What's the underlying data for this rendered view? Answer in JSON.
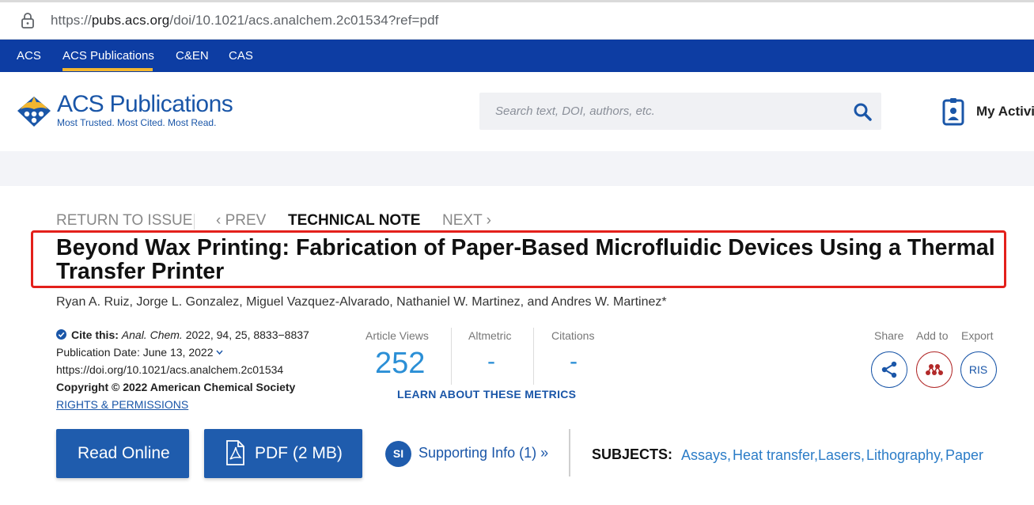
{
  "browser": {
    "url_prefix": "https://",
    "url_host": "pubs.acs.org",
    "url_path": "/doi/10.1021/acs.analchem.2c01534?ref=pdf"
  },
  "brand_nav": {
    "items": [
      {
        "label": "ACS",
        "active": false
      },
      {
        "label": "ACS Publications",
        "active": true
      },
      {
        "label": "C&EN",
        "active": false
      },
      {
        "label": "CAS",
        "active": false
      }
    ]
  },
  "header": {
    "logo_primary": "ACS",
    "logo_secondary": "Publications",
    "logo_tagline": "Most Trusted. Most Cited. Most Read.",
    "search_placeholder": "Search text, DOI, authors, etc.",
    "my_activity": "My Activit"
  },
  "article_nav": {
    "return": "RETURN TO ISSUE",
    "prev": "‹ PREV",
    "type": "TECHNICAL NOTE",
    "next": "NEXT ›"
  },
  "article": {
    "title": "Beyond Wax Printing: Fabrication of Paper-Based Microfluidic Devices Using a Thermal Transfer Printer",
    "authors": "Ryan A. Ruiz, Jorge L. Gonzalez, Miguel Vazquez-Alvarado, Nathaniel W. Martinez, and Andres W. Martinez*",
    "cite_label": "Cite this:",
    "cite_journal": "Anal. Chem.",
    "cite_details": "2022, 94, 25, 8833−8837",
    "pub_date": "Publication Date: June 13, 2022",
    "doi": "https://doi.org/10.1021/acs.analchem.2c01534",
    "copyright": "Copyright © 2022 American Chemical Society",
    "rights": "RIGHTS & PERMISSIONS"
  },
  "metrics": {
    "views_label": "Article Views",
    "views_value": "252",
    "altmetric_label": "Altmetric",
    "altmetric_value": "-",
    "citations_label": "Citations",
    "citations_value": "-",
    "learn_more": "LEARN ABOUT THESE METRICS"
  },
  "actions": {
    "share_label": "Share",
    "add_label": "Add to",
    "export_label": "Export",
    "export_button": "RIS"
  },
  "buttons": {
    "read_online": "Read Online",
    "pdf": "PDF (2 MB)",
    "si_badge": "SI",
    "supporting_info": "Supporting Info (1) »"
  },
  "subjects": {
    "label": "SUBJECTS:",
    "items": [
      "Assays,",
      "Heat transfer,",
      "Lasers,",
      "Lithography,",
      "Paper"
    ]
  },
  "colors": {
    "brand_blue": "#0d3da3",
    "button_blue": "#1f5cad",
    "metric_blue": "#2b8fd6",
    "highlight_red": "#e3201b",
    "accent_gold": "#f2b630"
  }
}
